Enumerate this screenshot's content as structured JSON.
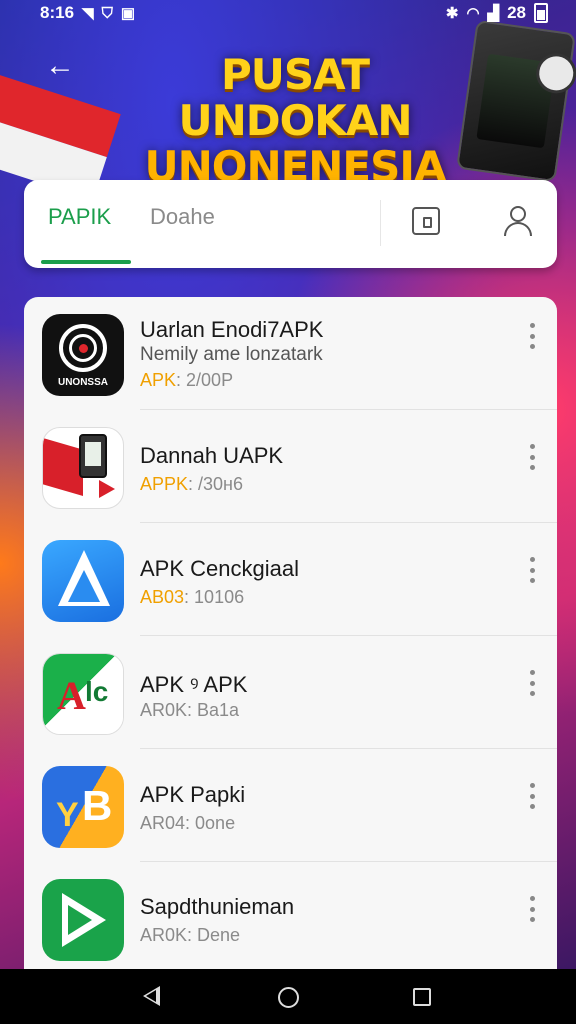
{
  "status_bar": {
    "time": "8:16",
    "battery": "28",
    "left_icons": [
      "location-icon",
      "shield-icon",
      "app-notification-icon"
    ],
    "right_icons": [
      "bluetooth-icon",
      "wifi-icon",
      "signal-icon",
      "battery-icon"
    ]
  },
  "header": {
    "title_line1": "PUSAT UNDOKAN",
    "title_line2": "UNONENESIA"
  },
  "tabs": [
    {
      "label": "PAPIK",
      "active": true
    },
    {
      "label": "Doahe",
      "active": false
    }
  ],
  "toolbar_icons": [
    "square-icon",
    "user-icon"
  ],
  "apps": [
    {
      "name": "Uarlan Enodi7APK",
      "subtitle": "Nemily ame lonzatark",
      "tag": "APK",
      "meta": ": 2/00P",
      "icon_caption": "UNONSSA",
      "icon": "camera-lens-icon"
    },
    {
      "name": "Dannah UAPK",
      "subtitle": "",
      "tag": "APPK",
      "meta": ": /30н6",
      "icon_caption": "",
      "icon": "flag-phone-icon"
    },
    {
      "name": "APK Cenckgiaal",
      "subtitle": "",
      "tag": "AB03",
      "meta": ": 10106",
      "icon_caption": "",
      "icon": "app-store-icon"
    },
    {
      "name": "APK ꝰ APK",
      "subtitle": "",
      "tag": "AR0K",
      "meta": ": Ba1a",
      "icon_caption": "",
      "icon": "alc-letters-icon"
    },
    {
      "name": "APK Papki",
      "subtitle": "",
      "tag": "AR04",
      "meta": ": 0one",
      "icon_caption": "",
      "icon": "yb-letters-icon"
    },
    {
      "name": "Sapdthunieman",
      "subtitle": "",
      "tag": "AR0K",
      "meta": ": Dene",
      "icon_caption": "",
      "icon": "play-triangle-icon"
    }
  ],
  "colors": {
    "accent_green": "#1b9e4b",
    "tag_orange": "#f0a000",
    "title_yellow": "#ffd21a"
  },
  "nav_bar": [
    "back-nav-icon",
    "home-nav-icon",
    "recents-nav-icon"
  ]
}
